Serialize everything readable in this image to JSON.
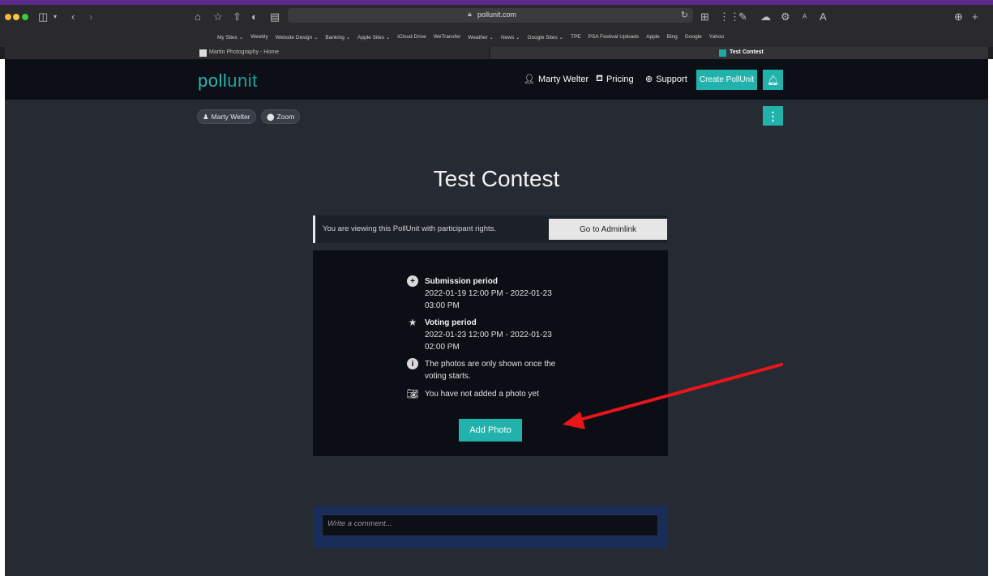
{
  "browser": {
    "url": "pollunit.com",
    "favorites": [
      "My Sites ⌄",
      "Weebly",
      "Website Design ⌄",
      "Banking ⌄",
      "Apple Sites ⌄",
      "iCloud Drive",
      "WeTransfer",
      "Weather ⌄",
      "News ⌄",
      "Google Sites ⌄",
      "TPE",
      "PSA Festival Uploads",
      "Apple",
      "Bing",
      "Google",
      "Yahoo"
    ],
    "tabs": [
      {
        "title": "Martin Photography - Home"
      },
      {
        "title": "Test Contest"
      }
    ]
  },
  "header": {
    "logo_bold": "poll",
    "logo_thin": "unit",
    "user": "Marty Welter",
    "pricing": "Pricing",
    "support": "Support",
    "create": "Create PollUnit"
  },
  "chips": {
    "owner": "Marty Welter",
    "location": "Zoom"
  },
  "contest": {
    "title": "Test Contest",
    "notice": "You are viewing this PollUnit with participant rights.",
    "admin_link": "Go to Adminlink",
    "submission_label": "Submission period",
    "submission_dates": "2022-01-19 12:00 PM - 2022-01-23 03:00 PM",
    "voting_label": "Voting period",
    "voting_dates": "2022-01-23 12:00 PM - 2022-01-23 02:00 PM",
    "info": "The photos are only shown once the voting starts.",
    "photo_status": "You have not added a photo yet",
    "add_photo": "Add Photo"
  },
  "comment": {
    "placeholder": "Write a comment..."
  },
  "colors": {
    "accent": "#22b2ac",
    "navbar": "#0c0f15",
    "page": "#262a32",
    "arrow": "#e8161b"
  }
}
